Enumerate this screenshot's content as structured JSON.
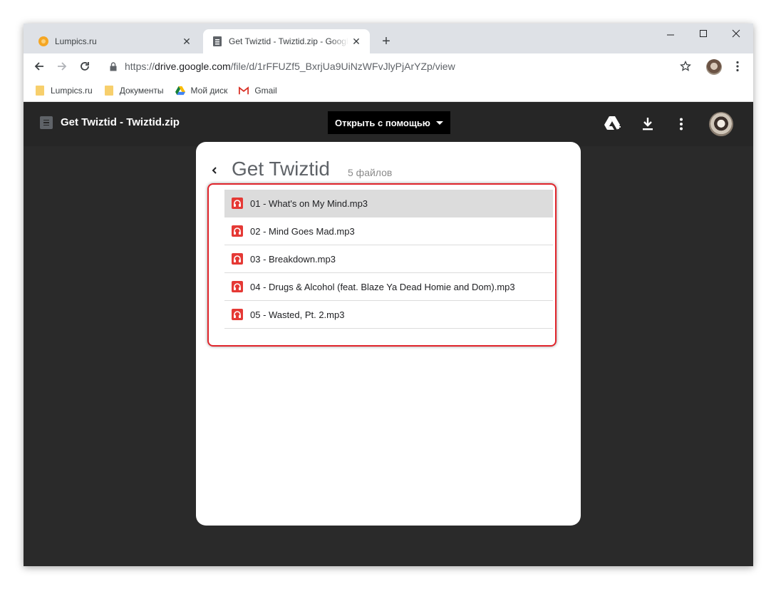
{
  "browser": {
    "tabs": [
      {
        "title": "Lumpics.ru",
        "favicon": "orange-circle-icon",
        "active": false
      },
      {
        "title": "Get Twiztid - Twiztid.zip - Google Drive",
        "favicon": "doc-icon",
        "active": true
      }
    ],
    "url": {
      "scheme": "https://",
      "host": "drive.google.com",
      "path": "/file/d/1rFFUZf5_BxrjUa9UiNzWFvJlyPjArYZp/view"
    },
    "bookmarks": [
      {
        "label": "Lumpics.ru",
        "icon": "folder-icon"
      },
      {
        "label": "Документы",
        "icon": "folder-icon"
      },
      {
        "label": "Мой диск",
        "icon": "drive-icon"
      },
      {
        "label": "Gmail",
        "icon": "gmail-icon"
      }
    ]
  },
  "viewer": {
    "file_title": "Get Twiztid - Twiztid.zip",
    "open_with_label": "Открыть с помощью"
  },
  "zip": {
    "name": "Get Twiztid",
    "count_label": "5 файлов",
    "files": [
      {
        "name": "01 - What's on My Mind.mp3",
        "selected": true
      },
      {
        "name": "02 - Mind Goes Mad.mp3",
        "selected": false
      },
      {
        "name": "03 - Breakdown.mp3",
        "selected": false
      },
      {
        "name": "04 - Drugs & Alcohol (feat. Blaze Ya Dead Homie and Dom).mp3",
        "selected": false
      },
      {
        "name": "05 - Wasted, Pt. 2.mp3",
        "selected": false
      }
    ]
  },
  "colors": {
    "highlight": "#e0242b",
    "audio_icon": "#e53935",
    "viewer_bg": "#2a2a2a"
  }
}
